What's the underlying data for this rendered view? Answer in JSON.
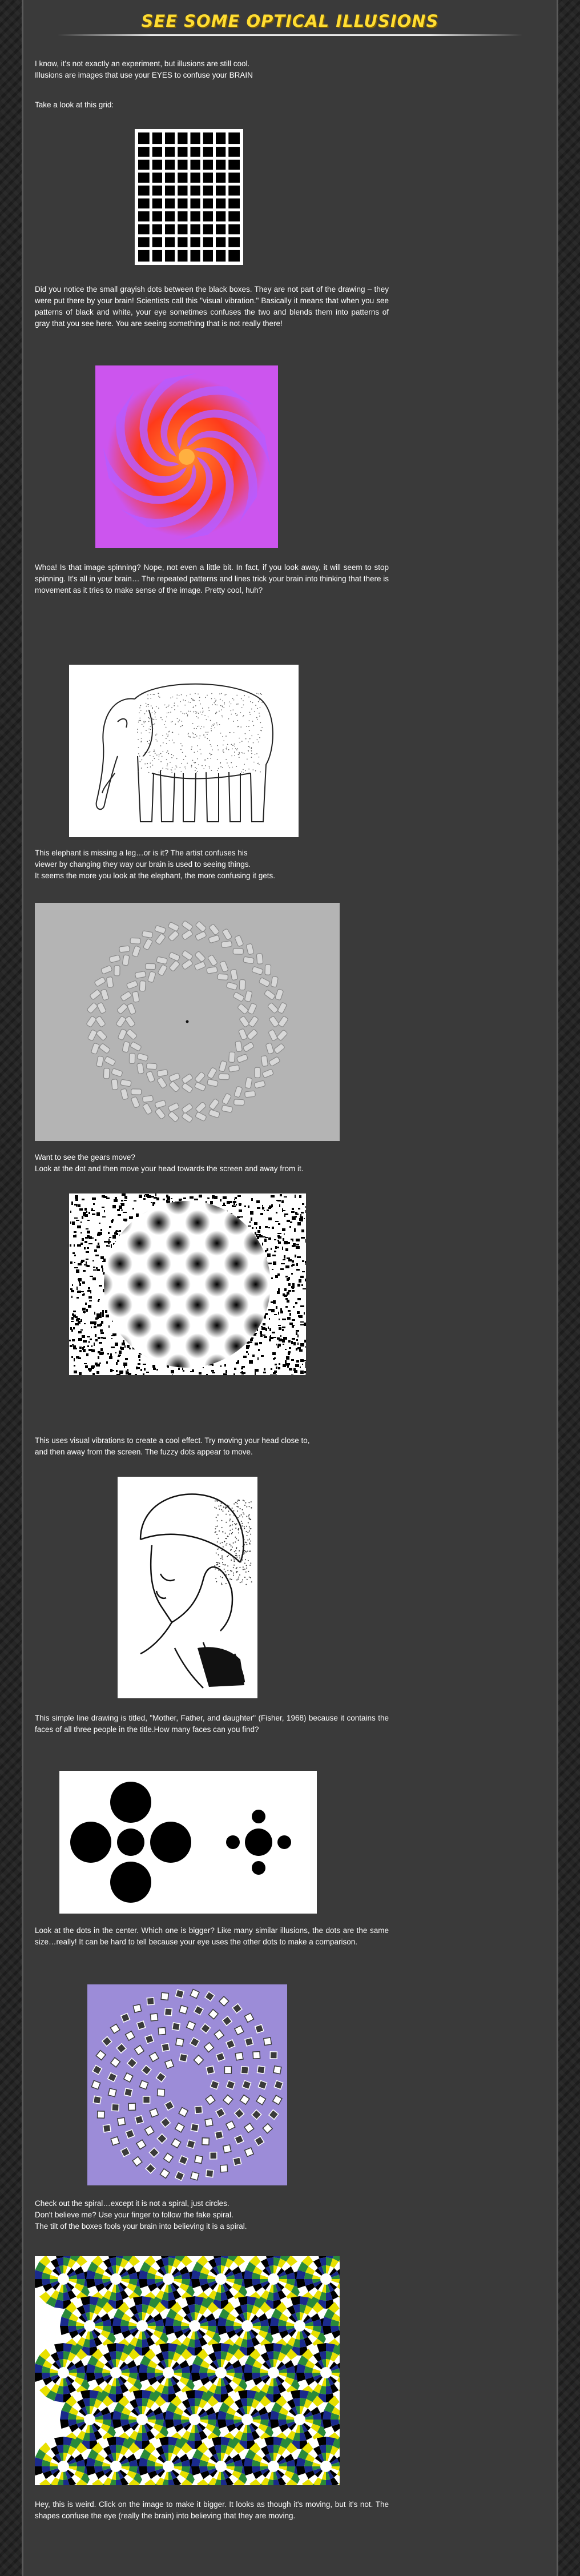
{
  "header": {
    "title": "SEE SOME OPTICAL ILLUSIONS"
  },
  "intro": [
    "I know, it's not exactly an experiment, but illusions are still cool.",
    "Illusions are images that use your EYES to confuse your BRAIN"
  ],
  "grid_prompt": "Take a look at this grid:",
  "sections": [
    {
      "image": "black-grid-illusion",
      "text": [
        "Did you notice the small grayish dots between the black boxes. They are not part of the drawing – they were put there by your brain! Scientists call this \"visual vibration.\" Basically it means that when you see patterns of black and white, your eye sometimes confuses the two and blends them into patterns of gray that you see here. You are seeing something that is not really there!"
      ]
    },
    {
      "image": "spinning-swirl-illusion",
      "text": [
        "Whoa! Is that image spinning? Nope, not even a little bit. In fact, if you look away, it will seem to stop spinning. It's all in your brain… The repeated patterns and lines trick your brain into thinking that there is movement as it tries to make sense of the image. Pretty cool, huh?"
      ]
    },
    {
      "image": "elephant-legs-illusion",
      "text": [
        "This elephant is missing a leg…or is it? The artist confuses his",
        "viewer by changing they way our brain is used to seeing things.",
        "It seems the more you look at the elephant, the more confusing it gets."
      ]
    },
    {
      "image": "moving-gears-illusion",
      "text": [
        "Want to see the gears move?",
        "Look at the dot and then move your head towards the screen and away from it."
      ]
    },
    {
      "image": "fuzzy-dots-illusion",
      "text": [
        "This uses visual vibrations to create a cool effect. Try moving your head close to,",
        "and then away from the screen. The fuzzy dots appear to move."
      ]
    },
    {
      "image": "hidden-faces-drawing",
      "text": [
        "This simple line drawing is titled, \"Mother, Father, and daughter\" (Fisher, 1968) because it contains the faces of all three people in the title.How many faces can you find?"
      ]
    },
    {
      "image": "dot-size-illusion",
      "text": [
        "Look at the dots in the center. Which one is bigger? Like many similar illusions, the dots are the same size…really! It can be hard to tell because your eye uses the other dots to make a comparison."
      ]
    },
    {
      "image": "false-spiral-illusion",
      "text": [
        "Check out the spiral…except it is not a spiral, just circles.",
        "Don't believe me? Use your finger to follow the fake spiral.",
        "The tilt of the boxes fools your brain into believing it is a spiral."
      ]
    },
    {
      "image": "rotating-snakes-illusion",
      "text": [
        "Hey, this is weird. Click on the image to make it bigger. It looks as though it's moving, but it's not. The shapes confuse the eye (really the brain) into believing that they are moving."
      ]
    }
  ],
  "colors": {
    "title": "#ffdd33",
    "panel": "#3a3a3a",
    "background": "#262626",
    "text": "#ffffff"
  }
}
